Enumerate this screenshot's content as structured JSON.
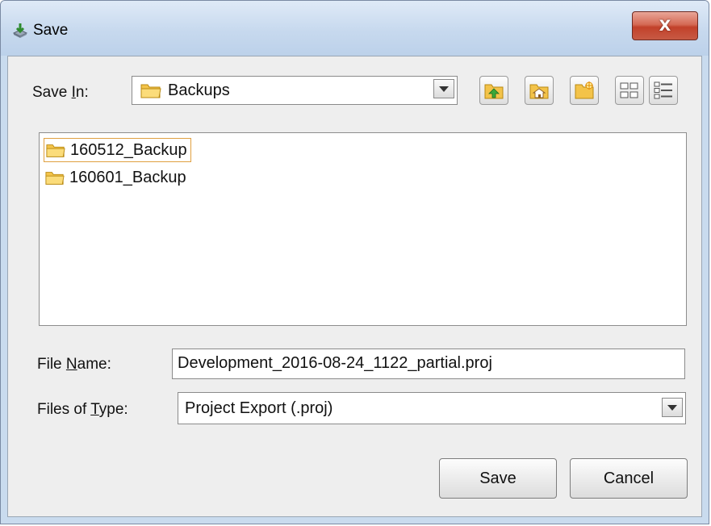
{
  "window": {
    "title": "Save",
    "close_symbol": "X"
  },
  "save_in": {
    "label_pre": "Save ",
    "label_mnemonic": "I",
    "label_post": "n:",
    "selected": "Backups",
    "icon": "folder-icon"
  },
  "toolbar": [
    {
      "name": "up-one-level-button",
      "icon": "folder-up-icon"
    },
    {
      "name": "home-button",
      "icon": "home-icon"
    },
    {
      "name": "new-folder-button",
      "icon": "new-folder-icon"
    },
    {
      "name": "list-view-button",
      "icon": "list-view-icon"
    },
    {
      "name": "details-view-button",
      "icon": "details-view-icon"
    }
  ],
  "files": [
    {
      "name": "160512_Backup",
      "icon": "folder-icon",
      "selected": true
    },
    {
      "name": "160601_Backup",
      "icon": "folder-icon",
      "selected": false
    }
  ],
  "file_name": {
    "label_pre": "File ",
    "label_mnemonic": "N",
    "label_post": "ame:",
    "value": "Development_2016-08-24_1122_partial.proj"
  },
  "files_of_type": {
    "label_pre": "Files of ",
    "label_mnemonic": "T",
    "label_post": "ype:",
    "selected": "Project Export (.proj)"
  },
  "buttons": {
    "save": "Save",
    "cancel": "Cancel"
  },
  "colors": {
    "title_bar": "#c7d9ee",
    "close_button": "#c75a44",
    "client_bg": "#eeeeee",
    "selection_border": "#e0a040"
  }
}
